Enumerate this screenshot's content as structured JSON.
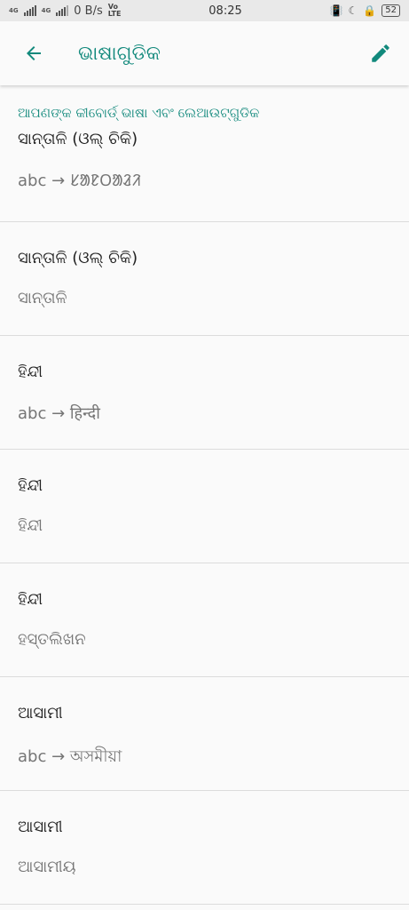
{
  "status_bar": {
    "net_a": "4G",
    "net_b": "4G",
    "speed": "0 B/s",
    "volte_top": "Vo",
    "volte_bottom": "LTE",
    "time": "08:25",
    "battery": "52"
  },
  "app_bar": {
    "title": "ଭାଷାଗୁଡିକ",
    "back_icon": "arrow-left-icon",
    "edit_icon": "pencil-icon",
    "accent": "#12897c"
  },
  "section": {
    "header": "ଆପଣଙ୍କ କୀବୋର୍ଡ୍ ଭାଷା ଏବଂ ଲେଆଉଟ୍‌ଗୁଡିକ"
  },
  "languages": [
    {
      "name": "ସାନ୍ତାଳି (ଓଲ୍ ଚିକି)",
      "layout": "abc → ᱥᱟᱱᱛᱟᱲᱤ"
    },
    {
      "name": "ସାନ୍ତାଳି (ଓଲ୍ ଚିକି)",
      "layout": "ସାନ୍ତାଳି"
    },
    {
      "name": "ହିନ୍ଦୀ",
      "layout": "abc → हिन्दी"
    },
    {
      "name": "ହିନ୍ଦୀ",
      "layout": "ହିନ୍ଦୀ"
    },
    {
      "name": "ହିନ୍ଦୀ",
      "layout": "ହସ୍ତଲିଖନ"
    },
    {
      "name": "ଆସାମୀ",
      "layout": "abc → অসমীয়া"
    },
    {
      "name": "ଆସାମୀ",
      "layout": "ଆସାମୀୟ"
    }
  ]
}
